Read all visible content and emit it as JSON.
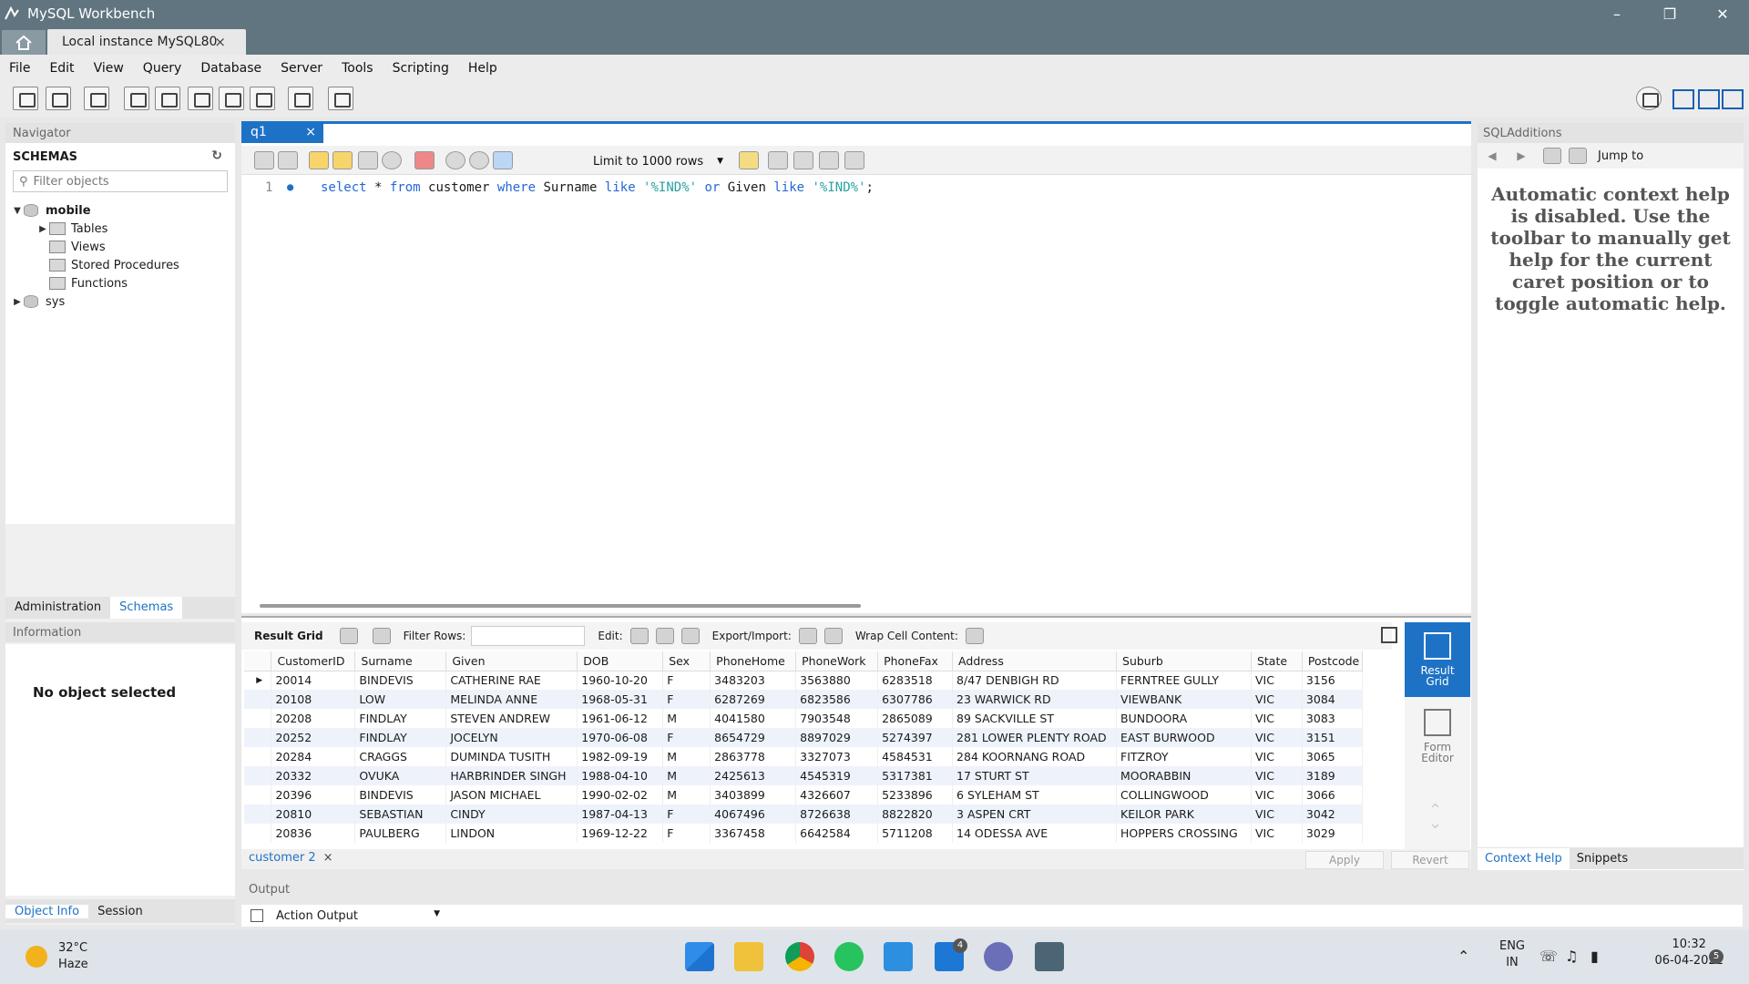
{
  "window": {
    "title": "MySQL Workbench"
  },
  "connection_tab": {
    "label": "Local instance MySQL80"
  },
  "menu": [
    "File",
    "Edit",
    "View",
    "Query",
    "Database",
    "Server",
    "Tools",
    "Scripting",
    "Help"
  ],
  "navigator": {
    "header": "Navigator",
    "schemas_title": "SCHEMAS",
    "filter_placeholder": "Filter objects",
    "tree": {
      "schema": "mobile",
      "children": [
        "Tables",
        "Views",
        "Stored Procedures",
        "Functions"
      ],
      "other": "sys"
    },
    "tabs": [
      "Administration",
      "Schemas"
    ],
    "info_header": "Information",
    "no_object": "No object selected",
    "bottom_tabs": [
      "Object Info",
      "Session"
    ]
  },
  "editor": {
    "tab_label": "q1",
    "limit_label": "Limit to 1000 rows",
    "line_number": "1",
    "sql": {
      "select": "select",
      "star": " * ",
      "from": "from",
      "table": " customer ",
      "where": "where",
      "col1": " Surname ",
      "like1": "like",
      "val1": " '%IND%' ",
      "or": "or",
      "col2": " Given ",
      "like2": "like",
      "val2": " '%IND%'",
      "end": ";"
    }
  },
  "results": {
    "toolbar": {
      "result_grid": "Result Grid",
      "filter_rows": "Filter Rows:",
      "edit": "Edit:",
      "export_import": "Export/Import:",
      "wrap": "Wrap Cell Content:"
    },
    "columns": [
      "CustomerID",
      "Surname",
      "Given",
      "DOB",
      "Sex",
      "PhoneHome",
      "PhoneWork",
      "PhoneFax",
      "Address",
      "Suburb",
      "State",
      "Postcode"
    ],
    "rows": [
      [
        "20014",
        "BINDEVIS",
        "CATHERINE RAE",
        "1960-10-20",
        "F",
        "3483203",
        "3563880",
        "6283518",
        "8/47 DENBIGH RD",
        "FERNTREE GULLY",
        "VIC",
        "3156"
      ],
      [
        "20108",
        "LOW",
        "MELINDA ANNE",
        "1968-05-31",
        "F",
        "6287269",
        "6823586",
        "6307786",
        "23 WARWICK RD",
        "VIEWBANK",
        "VIC",
        "3084"
      ],
      [
        "20208",
        "FINDLAY",
        "STEVEN ANDREW",
        "1961-06-12",
        "M",
        "4041580",
        "7903548",
        "2865089",
        "89 SACKVILLE ST",
        "BUNDOORA",
        "VIC",
        "3083"
      ],
      [
        "20252",
        "FINDLAY",
        "JOCELYN",
        "1970-06-08",
        "F",
        "8654729",
        "8897029",
        "5274397",
        "281 LOWER PLENTY ROAD",
        "EAST BURWOOD",
        "VIC",
        "3151"
      ],
      [
        "20284",
        "CRAGGS",
        "DUMINDA TUSITH",
        "1982-09-19",
        "M",
        "2863778",
        "3327073",
        "4584531",
        "284 KOORNANG ROAD",
        "FITZROY",
        "VIC",
        "3065"
      ],
      [
        "20332",
        "OVUKA",
        "HARBRINDER SINGH",
        "1988-04-10",
        "M",
        "2425613",
        "4545319",
        "5317381",
        "17 STURT ST",
        "MOORABBIN",
        "VIC",
        "3189"
      ],
      [
        "20396",
        "BINDEVIS",
        "JASON MICHAEL",
        "1990-02-02",
        "M",
        "3403899",
        "4326607",
        "5233896",
        "6 SYLEHAM ST",
        "COLLINGWOOD",
        "VIC",
        "3066"
      ],
      [
        "20810",
        "SEBASTIAN",
        "CINDY",
        "1987-04-13",
        "F",
        "4067496",
        "8726638",
        "8822820",
        "3 ASPEN CRT",
        "KEILOR PARK",
        "VIC",
        "3042"
      ],
      [
        "20836",
        "PAULBERG",
        "LINDON",
        "1969-12-22",
        "F",
        "3367458",
        "6642584",
        "5711208",
        "14 ODESSA AVE",
        "HOPPERS CROSSING",
        "VIC",
        "3029"
      ]
    ],
    "rail": {
      "result_grid_l1": "Result",
      "result_grid_l2": "Grid",
      "form_editor_l1": "Form",
      "form_editor_l2": "Editor"
    },
    "result_tab": "customer 2",
    "apply": "Apply",
    "revert": "Revert"
  },
  "output": {
    "header": "Output",
    "selector": "Action Output"
  },
  "sql_additions": {
    "header": "SQLAdditions",
    "jump_to": "Jump to",
    "help_text": "Automatic context help is disabled. Use the toolbar to manually get help for the current caret position or to toggle automatic help.",
    "tabs": [
      "Context Help",
      "Snippets"
    ]
  },
  "taskbar": {
    "temperature": "32°C",
    "weather": "Haze",
    "lang1": "ENG",
    "lang2": "IN",
    "time": "10:32",
    "date": "06-04-2022",
    "notification_count": "5",
    "store_badge": "4"
  },
  "colors": {
    "accent": "#1e72c6",
    "titlebar": "#607580"
  }
}
